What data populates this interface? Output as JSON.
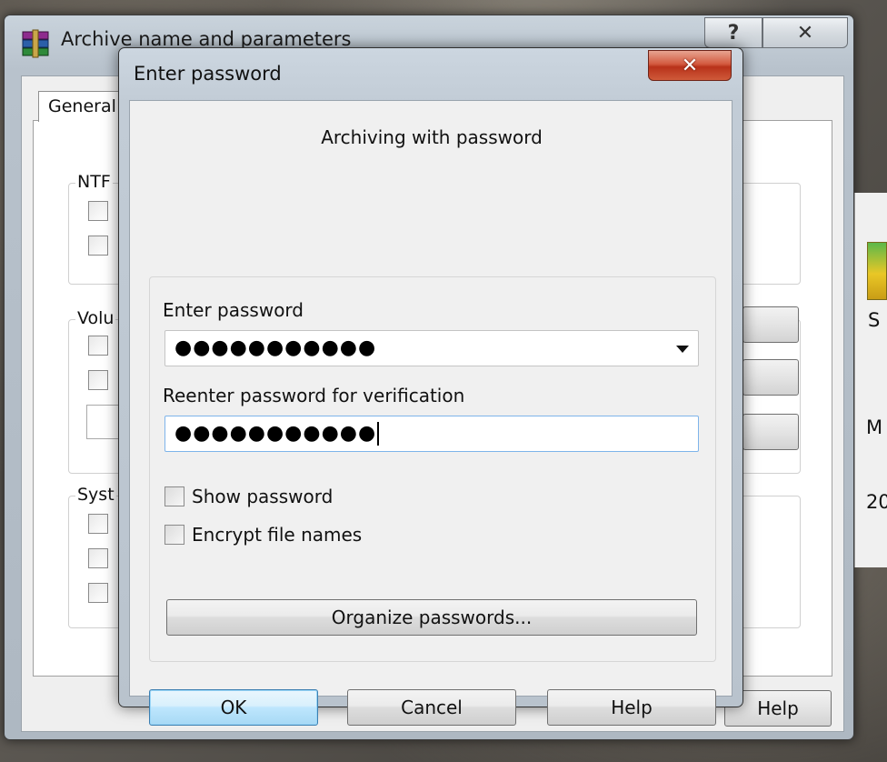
{
  "background_window": {
    "title": "Archive name and parameters",
    "help_caption": "?",
    "close_caption": "✕",
    "tab_general": "General",
    "group_ntfs": "NTF",
    "group_volume": "Volu",
    "group_system": "Syst",
    "help_button": "Help"
  },
  "desktop": {
    "fragment_m": "M",
    "fragment_20": "20",
    "fragment_s": "S"
  },
  "dialog": {
    "title": "Enter password",
    "close_caption": "✕",
    "heading": "Archiving with password",
    "enter_password_label": "Enter password",
    "password_value": "●●●●●●●●●●●",
    "reenter_label": "Reenter password for verification",
    "reenter_value": "●●●●●●●●●●●",
    "show_password_label": "Show password",
    "encrypt_names_label": "Encrypt file names",
    "organize_button": "Organize passwords...",
    "ok_button": "OK",
    "cancel_button": "Cancel",
    "help_button": "Help"
  }
}
